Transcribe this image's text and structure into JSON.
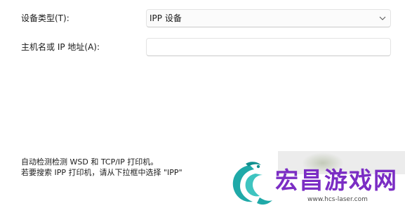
{
  "device_type": {
    "label": "设备类型(T):",
    "selected_value": "IPP 设备"
  },
  "host": {
    "label": "主机名或 IP 地址(A):",
    "value": ""
  },
  "hints": [
    "自动检测检测 WSD 和 TCP/IP 打印机。",
    "若要搜索 IPP 打印机，请从下拉框中选择 \"IPP\""
  ],
  "watermark": {
    "title": "宏昌游戏网",
    "url": "www.hcs-laser.com"
  },
  "colors": {
    "watermark_title": "#7b2dc4",
    "logo_teal": "#1fa9a8",
    "border": "#e3e3e3"
  }
}
